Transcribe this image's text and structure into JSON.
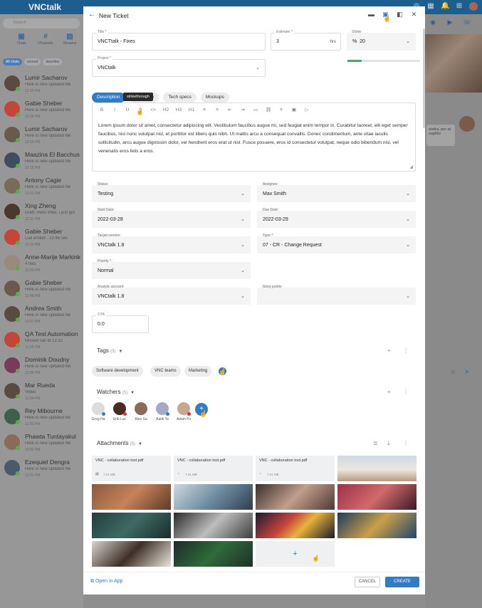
{
  "app": {
    "brand": "VNCtalk"
  },
  "left": {
    "search_placeholder": "Search",
    "nav": [
      {
        "label": "Chats",
        "icon": "chat-icon"
      },
      {
        "label": "Channels",
        "icon": "hash-icon"
      },
      {
        "label": "Streams",
        "icon": "streams-icon"
      }
    ],
    "filters": [
      "All chats",
      "unread",
      "favorites"
    ],
    "conversations": [
      {
        "name": "Lumir Sacharov",
        "sub": "Here is new updated file",
        "time": "12:19 PM"
      },
      {
        "name": "Gabie Sheber",
        "sub": "Here is new updated file",
        "time": "12:18 PM"
      },
      {
        "name": "Lumir Sacharov",
        "sub": "Here is new updated file",
        "time": "12:18 PM"
      },
      {
        "name": "Maazina El Bacchus",
        "sub": "Here is new updated file",
        "time": "12:15 PM"
      },
      {
        "name": "Antony Cagie",
        "sub": "Here is new updated file",
        "time": "12:12 PM"
      },
      {
        "name": "Xing Zheng",
        "sub": "Draft: Hello Mike, i just got",
        "time": "12:11 PM"
      },
      {
        "name": "Gabie Sheber",
        "sub": "Call ended · 22:46 sec",
        "time": "12:10 PM"
      },
      {
        "name": "Anne-Marije Markink",
        "sub": "4 files",
        "time": "12:09 PM"
      },
      {
        "name": "Gabie Sheber",
        "sub": "Here is new updated file",
        "time": "12:08 PM"
      },
      {
        "name": "Andrea Smith",
        "sub": "Here is new updated file",
        "time": "12:07 PM"
      },
      {
        "name": "QA Test Automation",
        "sub": "Missed call at 12:32",
        "time": "12:06 PM"
      },
      {
        "name": "Dominik Doudny",
        "sub": "Here is new updated file",
        "time": "12:05 PM"
      },
      {
        "name": "Mar Rueda",
        "sub": "Video",
        "time": "12:04 PM"
      },
      {
        "name": "Rey Mibourne",
        "sub": "Here is new updated file",
        "time": "12:03 PM"
      },
      {
        "name": "Phawta Tuntayakul",
        "sub": "Here is new updated file",
        "time": "12:02 PM"
      },
      {
        "name": "Ezequiel Dengra",
        "sub": "Here is new updated file",
        "time": "12:01 PM"
      }
    ]
  },
  "right": {
    "bubble_text": "ondra, per at sagittis"
  },
  "dialog": {
    "title": "New Ticket",
    "fields": {
      "title": {
        "label": "Title *",
        "value": "VNCTtalk - Fixes"
      },
      "estimate": {
        "label": "Estimate *",
        "value": "3",
        "suffix": "hrs"
      },
      "done": {
        "label": "Done",
        "prefix": "%",
        "value": "20",
        "percent": 20
      },
      "project": {
        "label": "Project *",
        "value": "VNCtalk"
      },
      "status": {
        "label": "Status",
        "value": "Testing"
      },
      "assignee": {
        "label": "Assignee",
        "value": "Max Smith"
      },
      "start_date": {
        "label": "Start Date",
        "value": "2022-03-28"
      },
      "due_date": {
        "label": "Due Date",
        "value": "2022-03-29"
      },
      "target_version": {
        "label": "Target version",
        "value": "VNCtalk 1.8"
      },
      "type": {
        "label": "Type *",
        "value": "07 - CR - Change Request"
      },
      "priority": {
        "label": "Priority *",
        "value": "Normal"
      },
      "analytic_account": {
        "label": "Analytic account",
        "value": "VNCtalk 1.8"
      },
      "story_points": {
        "label": "Story points",
        "value": ""
      },
      "ota": {
        "label": "OTA",
        "value": "0.0"
      }
    },
    "tabs": [
      "Description",
      "Hierarchy",
      "Tech specs",
      "Mockups"
    ],
    "tooltip": "strikethrough",
    "toolbar": [
      "B",
      "I",
      "U",
      "S",
      "<>",
      "H2",
      "H3",
      "H1",
      "≡",
      "≡",
      "⇤",
      "⇥",
      "▭",
      "⛓",
      "⌗",
      "▣",
      "▷"
    ],
    "description": "Lorem ipsum dolor sit amet, consectetur adipiscing elit. Vestibulum faucibus augue mi, sed feugiat enim tempor in. Curabitur laoreet, elit eget semper faucibus, nisi nunc volutpat nisl, et porttitor est libero quis nibh. Ut mattis arcu a consequat convallis. Donec condimentum, ante vitae iaculis sollicitudin, arcu augue dignissim dolor, vel hendrerit eros erat ut nisl. Fusce posuere, eros id consectetur volutpat, neque odio bibendum nisi, vel venenatis eros felis a eros.",
    "tags": {
      "title": "Tags",
      "count": "(3)",
      "items": [
        "Software development",
        "VNC teams",
        "Marketing"
      ]
    },
    "watchers": {
      "title": "Watchers",
      "count": "(5)",
      "items": [
        {
          "name": "Greg Ha"
        },
        {
          "name": "Erik Luc"
        },
        {
          "name": "Alex Sa"
        },
        {
          "name": "Aatik Ta"
        },
        {
          "name": "Adam Fo"
        }
      ]
    },
    "attachments": {
      "title": "Attachments",
      "count": "(5)",
      "files": [
        {
          "name": "VNC - collaboration tool.pdf",
          "size": "7.21 MB"
        },
        {
          "name": "VNC - collaboration tool.pdf",
          "size": "7.21 MB"
        },
        {
          "name": "VNC - collaboration tool.pdf",
          "size": "7.21 MB"
        }
      ]
    },
    "open_in_app": "Open in App",
    "cancel": "CANCEL",
    "create": "CREATE"
  }
}
